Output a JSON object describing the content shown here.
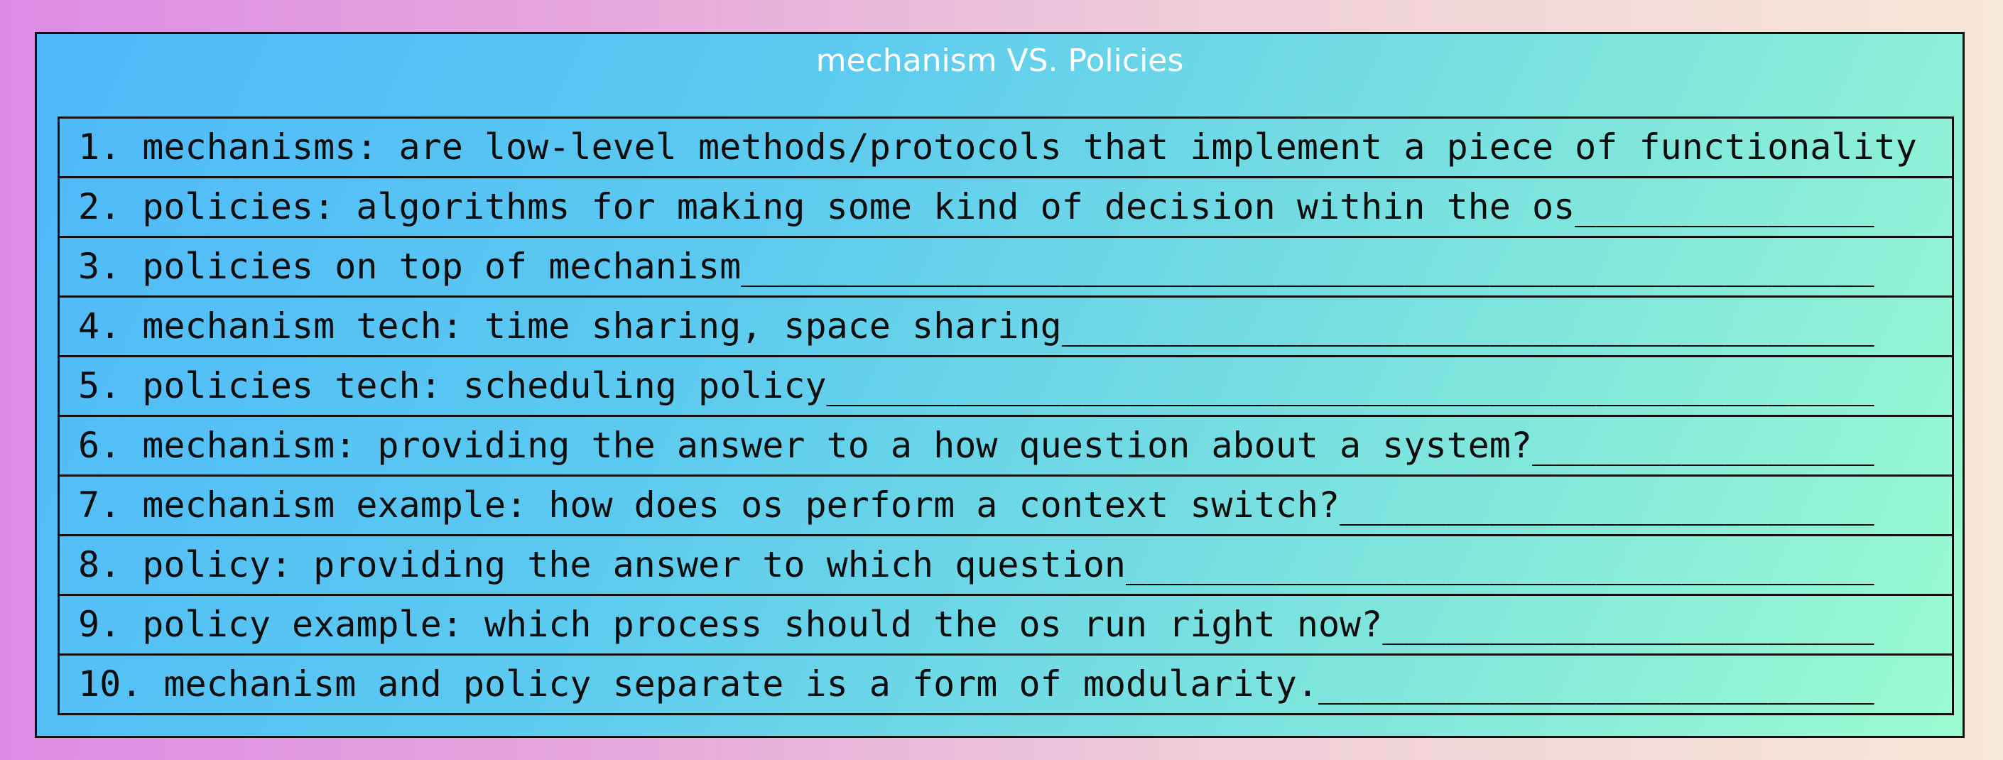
{
  "title": "mechanism VS. Policies",
  "rows": [
    "1. mechanisms: are low-level methods/protocols that implement a piece of functionality",
    "2. policies: algorithms for making some kind of decision within the os______________",
    "3. policies on top of mechanism_____________________________________________________",
    "4. mechanism tech: time sharing, space sharing______________________________________",
    "5. policies tech: scheduling policy_________________________________________________",
    "6. mechanism: providing the answer to a how question about a system?________________",
    "7. mechanism example: how does os perform a context switch?_________________________",
    "8. policy: providing the answer to which question___________________________________",
    "9. policy example: which process should the os run right now?_______________________",
    "10. mechanism and policy separate is a form of modularity.__________________________"
  ]
}
